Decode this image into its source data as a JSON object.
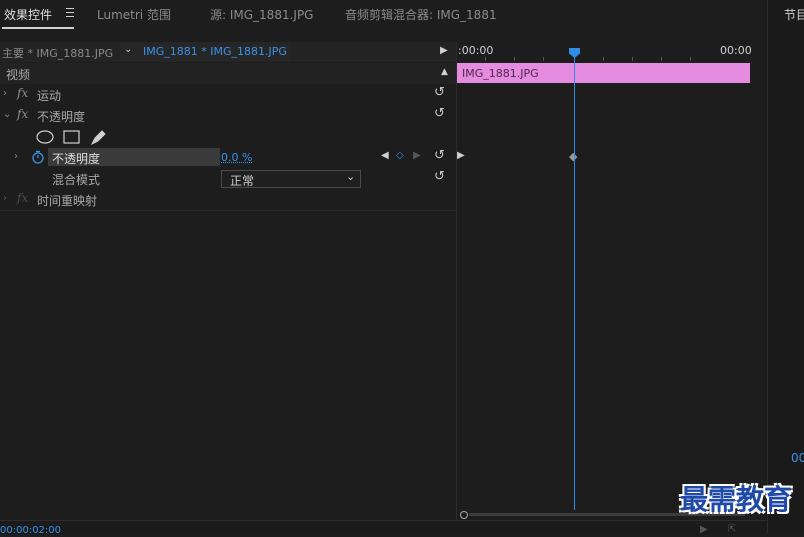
{
  "tabs": [
    {
      "label": "效果控件"
    },
    {
      "label": "Lumetri 范围"
    },
    {
      "label": "源: IMG_1881.JPG"
    },
    {
      "label": "音频剪辑混合器: IMG_1881"
    }
  ],
  "right_panel_title": "节目",
  "right_timecode_partial": "00",
  "clip_header": {
    "master_label": "主要 * IMG_1881.JPG",
    "clip_label": "IMG_1881 * IMG_1881.JPG"
  },
  "section_video": "视频",
  "effects": {
    "motion": "运动",
    "opacity": "不透明度",
    "opacity_param": "不透明度",
    "opacity_value": "0.0 %",
    "blend_mode_label": "混合模式",
    "blend_mode_value": "正常",
    "time_remap": "时间重映射"
  },
  "fx_glyph": "fx",
  "ruler": {
    "start": ":00:00",
    "end": "00:00"
  },
  "clip_bar_label": "IMG_1881.JPG",
  "bottom_timecode": "00:00:02:00",
  "watermark": "最需教育",
  "colors": {
    "accent": "#2f8de4",
    "clip": "#e58be0"
  }
}
